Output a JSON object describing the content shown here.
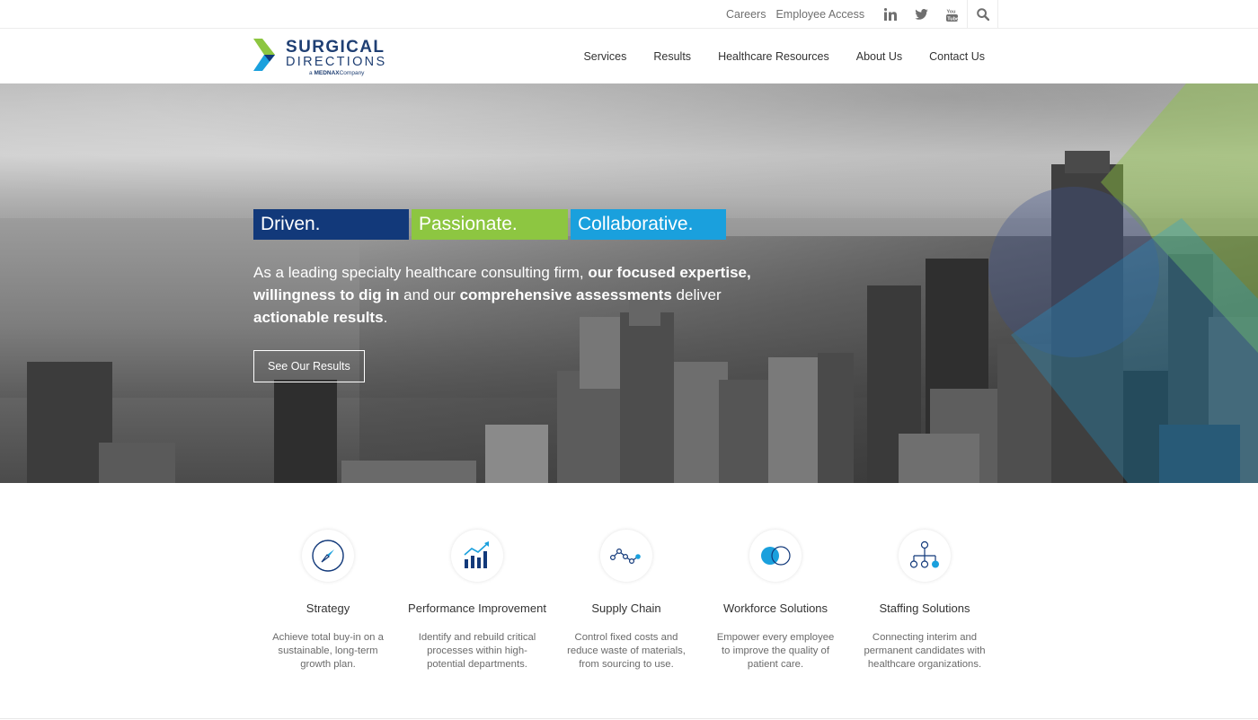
{
  "utility": {
    "careers": "Careers",
    "employee_access": "Employee Access",
    "icons": [
      "linkedin-icon",
      "twitter-icon",
      "youtube-icon",
      "search-icon"
    ]
  },
  "logo": {
    "line1": "SURGICAL",
    "line2": "DIRECTIONS",
    "tag_prefix": "a",
    "tag_brand": "MEDNAX",
    "tag_suffix": "Company",
    "colors": {
      "green": "#8dc641",
      "blue": "#1aa0dd",
      "navy": "#1f3f73"
    }
  },
  "nav": {
    "items": [
      "Services",
      "Results",
      "Healthcare Resources",
      "About Us",
      "Contact Us"
    ]
  },
  "hero": {
    "tags": [
      "Driven.",
      "Passionate.",
      "Collaborative."
    ],
    "tag_colors": [
      "#12397a",
      "#8dc641",
      "#1aa0dd"
    ],
    "text": {
      "p1": "As a leading specialty healthcare consulting firm, ",
      "s1": "our focused expertise,",
      "s2": "willingness to dig in",
      "p2": " and our ",
      "s3": "comprehensive assessments",
      "p3": " deliver ",
      "s4": "actionable results",
      "p4": "."
    },
    "button": "See Our Results"
  },
  "services": [
    {
      "icon": "compass-icon",
      "title": "Strategy",
      "desc": "Achieve total buy-in on a sustainable, long-term growth plan."
    },
    {
      "icon": "growth-chart-icon",
      "title": "Performance Improvement",
      "desc": "Identify and rebuild critical processes within high-potential departments."
    },
    {
      "icon": "supply-chain-icon",
      "title": "Supply Chain",
      "desc": "Control fixed costs and reduce waste of materials, from sourcing to use."
    },
    {
      "icon": "overlapping-circles-icon",
      "title": "Workforce Solutions",
      "desc": "Empower every employee to improve the quality of patient care."
    },
    {
      "icon": "org-chart-icon",
      "title": "Staffing Solutions",
      "desc": "Connecting interim and permanent candidates with healthcare organizations."
    }
  ]
}
